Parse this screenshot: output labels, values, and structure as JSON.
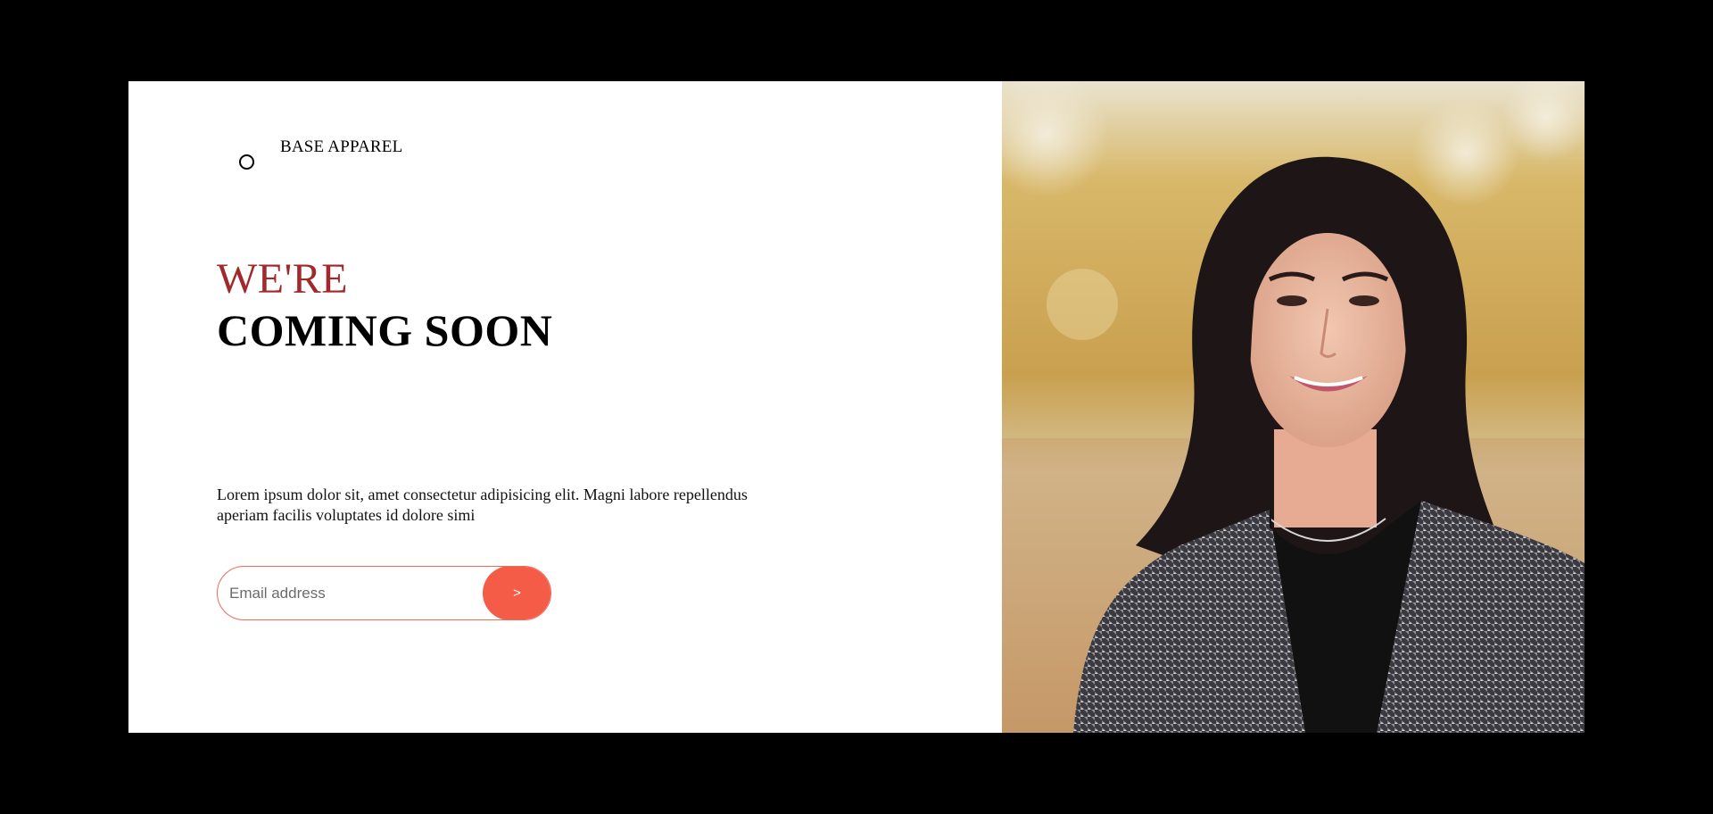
{
  "brand": {
    "name": "BASE APPAREL",
    "logo_icon": "circle-outline-icon"
  },
  "hero": {
    "line1": "WE'RE",
    "line2": "COMING SOON"
  },
  "description": "Lorem ipsum dolor sit, amet consectetur adipisicing elit. Magni labore repellendus aperiam facilis voluptates id dolore simi",
  "form": {
    "email_placeholder": "Email address",
    "email_value": "",
    "submit_label": ">"
  },
  "colors": {
    "accent": "#f55c47",
    "headline_red": "#a1282b",
    "frame": "#000000"
  }
}
